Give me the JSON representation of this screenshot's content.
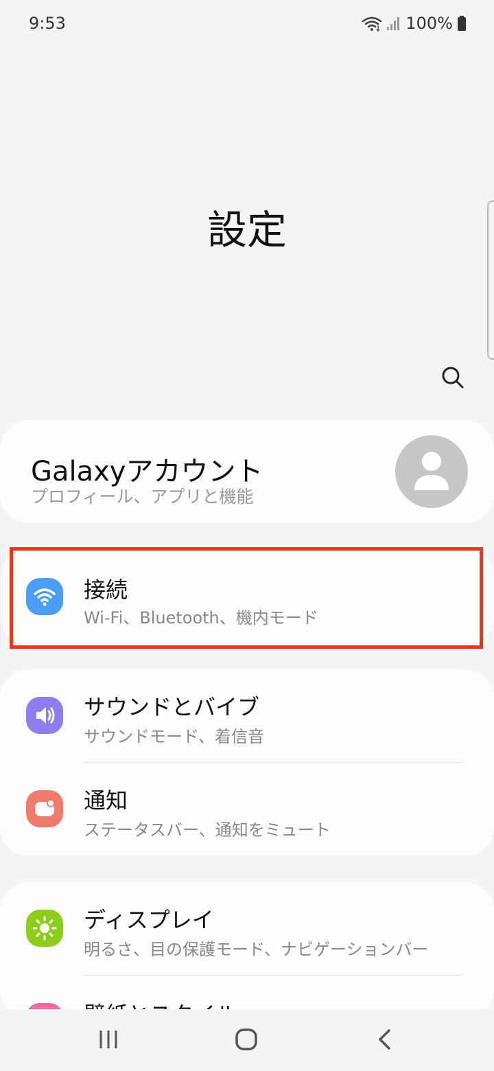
{
  "status_bar": {
    "time": "9:53",
    "battery": "100%"
  },
  "header": {
    "title": "設定"
  },
  "account": {
    "title": "Galaxyアカウント",
    "subtitle": "プロフィール、アプリと機能"
  },
  "items": [
    {
      "title": "接続",
      "subtitle": "Wi-Fi、Bluetooth、機内モード",
      "icon": "wifi-icon",
      "color": "#4a9cf5"
    },
    {
      "title": "サウンドとバイブ",
      "subtitle": "サウンドモード、着信音",
      "icon": "speaker-icon",
      "color": "#8f7df0"
    },
    {
      "title": "通知",
      "subtitle": "ステータスバー、通知をミュート",
      "icon": "notification-icon",
      "color": "#f27a6c"
    },
    {
      "title": "ディスプレイ",
      "subtitle": "明るさ、目の保護モード、ナビゲーションバー",
      "icon": "sun-icon",
      "color": "#8ecc1c"
    },
    {
      "title": "壁紙とスタイル",
      "icon": "wallpaper-icon",
      "color": "#f06b9d"
    }
  ],
  "colors": {
    "highlight": "#e5391d",
    "background": "#f4f4f4",
    "card": "#fcfcfc"
  }
}
